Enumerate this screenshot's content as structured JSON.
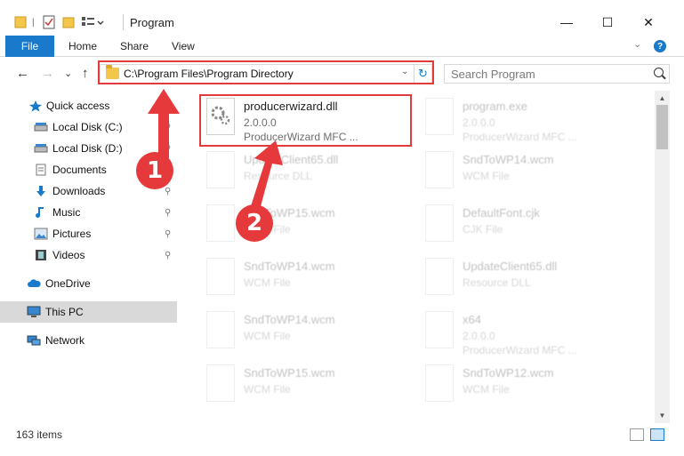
{
  "window": {
    "title": "Program",
    "minimize": "—",
    "maximize": "☐",
    "close": "✕"
  },
  "ribbon": {
    "file_tab": "File",
    "tabs": [
      "Home",
      "Share",
      "View"
    ],
    "help": "?"
  },
  "nav": {
    "back": "←",
    "forward": "→",
    "recent": "⌄",
    "up": "↑",
    "address": "C:\\Program Files\\Program Directory",
    "search_placeholder": "Search Program"
  },
  "sidebar": {
    "items": [
      {
        "label": "Quick access",
        "icon": "star-icon",
        "pinned": false
      },
      {
        "label": "Local Disk (C:)",
        "icon": "drive-icon",
        "pinned": true
      },
      {
        "label": "Local Disk (D:)",
        "icon": "drive-icon",
        "pinned": true
      },
      {
        "label": "Documents",
        "icon": "documents-icon",
        "pinned": true
      },
      {
        "label": "Downloads",
        "icon": "download-icon",
        "pinned": true
      },
      {
        "label": "Music",
        "icon": "music-icon",
        "pinned": true
      },
      {
        "label": "Pictures",
        "icon": "pictures-icon",
        "pinned": true
      },
      {
        "label": "Videos",
        "icon": "videos-icon",
        "pinned": true
      },
      {
        "label": "OneDrive",
        "icon": "cloud-icon",
        "pinned": false
      },
      {
        "label": "This PC",
        "icon": "computer-icon",
        "pinned": false,
        "selected": true
      },
      {
        "label": "Network",
        "icon": "network-icon",
        "pinned": false
      }
    ],
    "pin_glyph": "📌"
  },
  "files": [
    {
      "name": "producerwizard.dll",
      "line1": "2.0.0.0",
      "line2": "ProducerWizard MFC ...",
      "highlight": true
    },
    {
      "name": "program.exe",
      "line1": "2.0.0.0",
      "line2": "ProducerWizard MFC ..."
    },
    {
      "name": "UpdateClient65.dll",
      "line1": "Resource DLL",
      "line2": ""
    },
    {
      "name": "SndToWP14.wcm",
      "line1": "WCM File",
      "line2": ""
    },
    {
      "name": "SndToWP15.wcm",
      "line1": "WCM File",
      "line2": ""
    },
    {
      "name": "DefaultFont.cjk",
      "line1": "CJK File",
      "line2": ""
    },
    {
      "name": "SndToWP14.wcm",
      "line1": "WCM File",
      "line2": ""
    },
    {
      "name": "UpdateClient65.dll",
      "line1": "Resource DLL",
      "line2": ""
    },
    {
      "name": "SndToWP14.wcm",
      "line1": "WCM File",
      "line2": ""
    },
    {
      "name": "x64",
      "line1": "2.0.0.0",
      "line2": "ProducerWizard MFC ..."
    },
    {
      "name": "SndToWP15.wcm",
      "line1": "WCM File",
      "line2": ""
    },
    {
      "name": "SndToWP12.wcm",
      "line1": "WCM File",
      "line2": ""
    }
  ],
  "status": {
    "count": "163 items"
  },
  "annotations": {
    "step1": "1",
    "step2": "2"
  },
  "colors": {
    "accent": "#1979ca",
    "annotation": "#e13b3b"
  }
}
